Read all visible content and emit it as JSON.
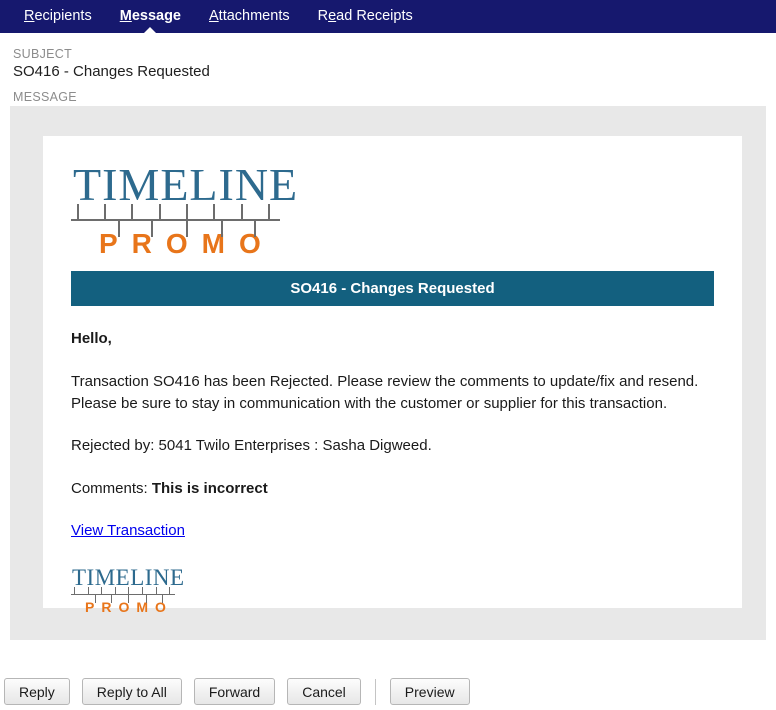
{
  "nav": {
    "tabs": [
      {
        "label": "Recipients",
        "accel_index": 0,
        "active": false
      },
      {
        "label": "Message",
        "accel_index": 0,
        "active": true
      },
      {
        "label": "Attachments",
        "accel_index": 0,
        "active": false
      },
      {
        "label": "Read Receipts",
        "accel_index": 1,
        "active": false
      }
    ]
  },
  "form": {
    "subject_label": "SUBJECT",
    "subject_value": "SO416 - Changes Requested",
    "message_label": "MESSAGE"
  },
  "email": {
    "logo": {
      "word_primary": "TIMELINE",
      "word_secondary": "PROMO",
      "primary_color": "#2d6a8e",
      "secondary_color": "#e8751a",
      "rule_color": "#6d6d6d"
    },
    "banner": {
      "text": "SO416 - Changes Requested",
      "background": "#13607f",
      "color": "#ffffff"
    },
    "greeting": "Hello,",
    "paragraph": "Transaction SO416 has been Rejected. Please review the comments to update/fix and resend. Please be sure to stay in communication with the customer or supplier for this transaction.",
    "rejected_by": "Rejected by: 5041 Twilo Enterprises : Sasha Digweed.",
    "comments_label": "Comments:",
    "comments_value": "This is incorrect",
    "link_text": "View Transaction",
    "link_color": "#0000ee"
  },
  "buttons": [
    {
      "label": "Reply"
    },
    {
      "label": "Reply to All"
    },
    {
      "label": "Forward"
    },
    {
      "label": "Cancel"
    },
    {
      "label": "Preview"
    }
  ]
}
